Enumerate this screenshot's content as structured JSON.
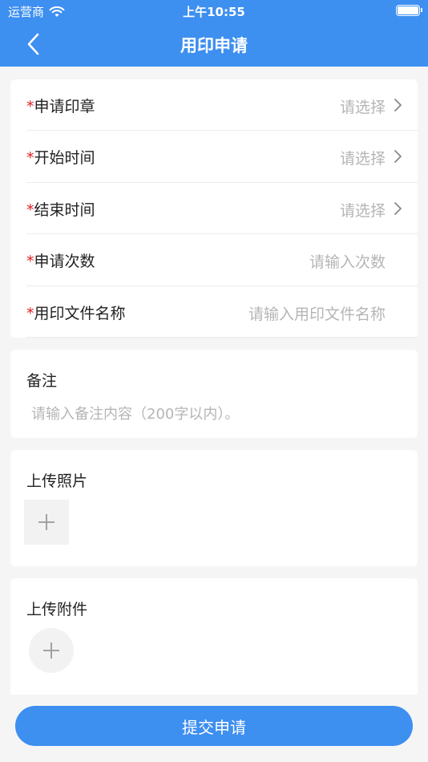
{
  "status_bar": {
    "carrier": "运营商",
    "time": "上午10:55"
  },
  "nav": {
    "title": "用印申请"
  },
  "form": {
    "required_mark": "*",
    "rows": [
      {
        "label": "申请印章",
        "placeholder": "请选择"
      },
      {
        "label": "开始时间",
        "placeholder": "请选择"
      },
      {
        "label": "结束时间",
        "placeholder": "请选择"
      },
      {
        "label": "申请次数",
        "placeholder": "请输入次数"
      },
      {
        "label": "用印文件名称",
        "placeholder": "请输入用印文件名称"
      }
    ]
  },
  "remark": {
    "title": "备注",
    "placeholder": "请输入备注内容（200字以内）。"
  },
  "photo": {
    "title": "上传照片"
  },
  "attachment": {
    "title": "上传附件"
  },
  "submit": {
    "label": "提交申请"
  },
  "colors": {
    "primary": "#3d8ff0",
    "required": "#e02020",
    "placeholder": "#b5b5b5"
  }
}
